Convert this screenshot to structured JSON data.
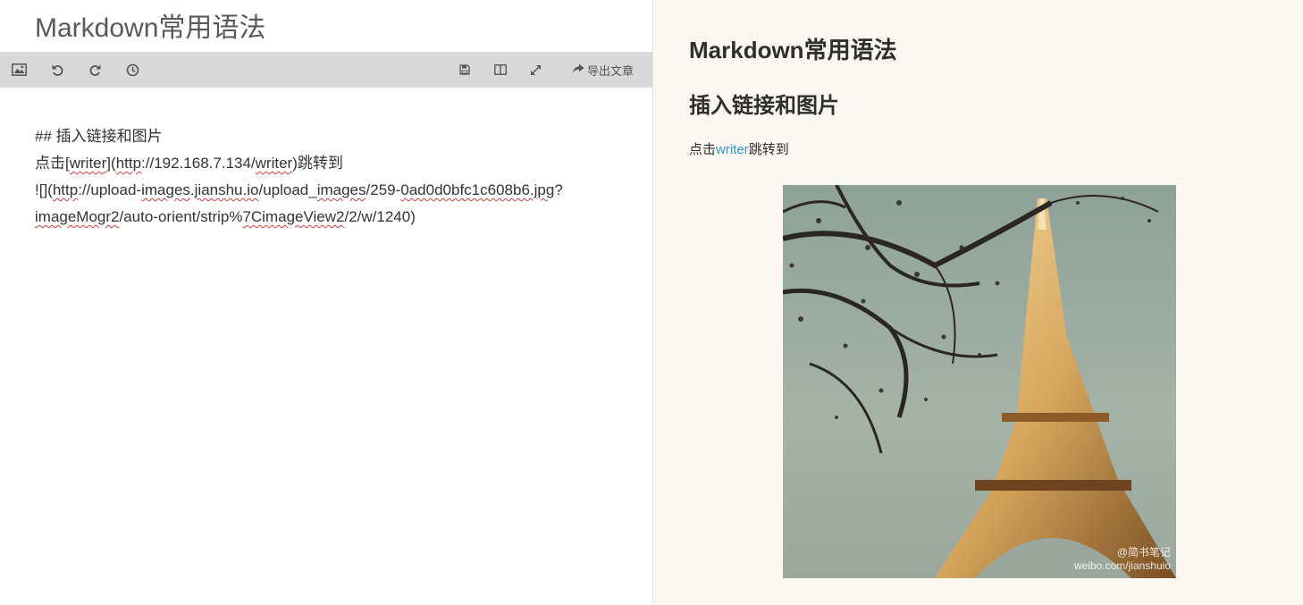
{
  "editor": {
    "title": "Markdown常用语法",
    "toolbar": {
      "export_label": "导出文章",
      "icons": [
        "image-icon",
        "undo-icon",
        "redo-icon",
        "history-icon",
        "save-icon",
        "split-view-icon",
        "fullscreen-icon",
        "share-icon"
      ]
    },
    "lines": [
      "## 插入链接和图片",
      "点击[writer](http://192.168.7.134/writer)跳转到",
      "![](http://upload-images.jianshu.io/upload_images/259-0ad0d0bfc1c608b6.jpg?",
      "imageMogr2/auto-orient/strip%7CimageView2/2/w/1240)"
    ]
  },
  "preview": {
    "h1": "Markdown常用语法",
    "h2": "插入链接和图片",
    "paragraph_prefix": "点击",
    "link_text": "writer",
    "paragraph_suffix": "跳转到",
    "image_watermark_line1": "@简书笔记",
    "image_watermark_line2": "weibo.com/jianshuio",
    "link_color": "#3194d0",
    "background": "#fbf8f2"
  }
}
